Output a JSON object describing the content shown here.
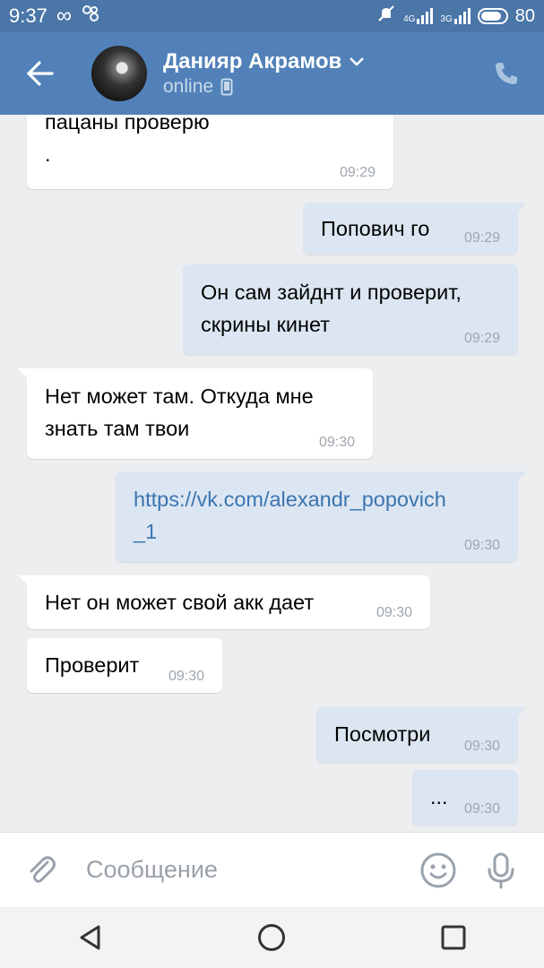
{
  "status": {
    "time": "9:37",
    "infinity": "∞",
    "network_4g": "4G",
    "network_3g": "3G",
    "battery": "80"
  },
  "header": {
    "name": "Данияр Акрамов",
    "status": "online",
    "back_icon": "arrow-left-icon",
    "phone_icon": "phone-icon",
    "chevron_icon": "chevron-down-icon",
    "mobile_icon": "mobile-icon"
  },
  "messages": [
    {
      "dir": "in",
      "lines": [
        "пацаны проверю",
        "."
      ],
      "time": "09:29"
    },
    {
      "dir": "out",
      "lines": [
        "Попович го"
      ],
      "time": "09:29"
    },
    {
      "dir": "out",
      "lines": [
        "Он сам зайднт и проверит,",
        "скрины кинет"
      ],
      "time": "09:29"
    },
    {
      "dir": "in",
      "lines": [
        "Нет может там. Откуда мне",
        "знать там твои"
      ],
      "time": "09:30"
    },
    {
      "dir": "out",
      "lines": [
        "https://vk.com/alexandr_popovich",
        "_1"
      ],
      "time": "09:30"
    },
    {
      "dir": "in",
      "lines": [
        "Нет он может свой акк дает"
      ],
      "time": "09:30"
    },
    {
      "dir": "in",
      "lines": [
        "Проверит"
      ],
      "time": "09:30"
    },
    {
      "dir": "out",
      "lines": [
        "Посмотри"
      ],
      "time": "09:30"
    },
    {
      "dir": "out",
      "lines": [
        "..."
      ],
      "time": "09:30"
    }
  ],
  "input": {
    "placeholder": "Сообщение",
    "attach_icon": "paperclip-icon",
    "emoji_icon": "smiley-icon",
    "mic_icon": "microphone-icon"
  },
  "navbar": {
    "back_icon": "nav-back-icon",
    "home_icon": "nav-home-icon",
    "recents_icon": "nav-recents-icon"
  },
  "colors": {
    "header": "#5181b8",
    "status_bar": "#4a76a8",
    "background": "#edeef0",
    "incoming": "#ffffff",
    "outgoing": "#dce6f2",
    "link": "#3b75b0"
  }
}
